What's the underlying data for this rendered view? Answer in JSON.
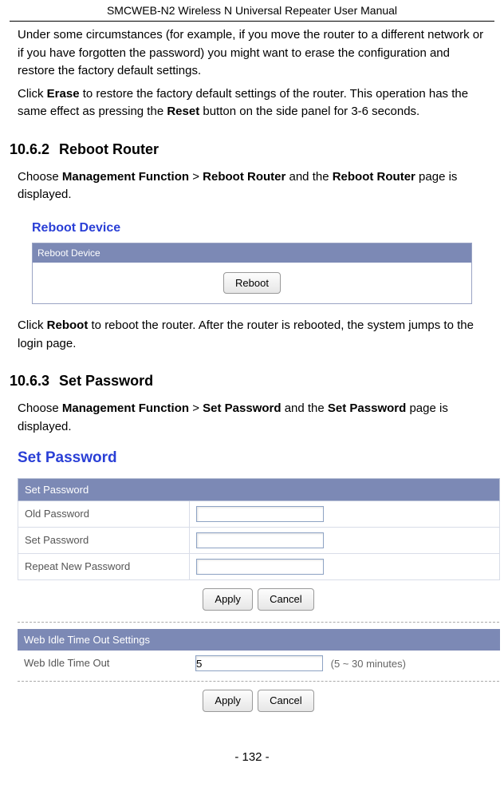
{
  "header": {
    "title": "SMCWEB-N2 Wireless N Universal Repeater User Manual"
  },
  "intro": {
    "p1": "Under some circumstances (for example, if you move the router to a different network or if you have forgotten the password) you might want to erase the configuration and restore the factory default settings.",
    "p2a": "Click ",
    "p2b": "Erase",
    "p2c": " to restore the factory default settings of the router. This operation has the same effect as pressing the ",
    "p2d": "Reset",
    "p2e": " button on the side panel for 3-6 seconds."
  },
  "sec1": {
    "num": "10.6.2",
    "title": "Reboot Router",
    "p_a": "Choose ",
    "p_b": "Management Function",
    "p_c": " > ",
    "p_d": "Reboot Router",
    "p_e": " and the ",
    "p_f": "Reboot Router",
    "p_g": " page is displayed.",
    "panel_title": "Reboot Device",
    "panel_head": "Reboot Device",
    "reboot_btn": "Reboot",
    "after_a": "Click ",
    "after_b": "Reboot",
    "after_c": " to reboot the router. After the router is rebooted, the system jumps to the login page."
  },
  "sec2": {
    "num": "10.6.3",
    "title": "Set Password",
    "p_a": "Choose ",
    "p_b": "Management Function",
    "p_c": " > ",
    "p_d": "Set Password",
    "p_e": " and the ",
    "p_f": "Set Password",
    "p_g": " page is displayed.",
    "panel_title": "Set Password",
    "th1": "Set Password",
    "row1": "Old Password",
    "row2": "Set Password",
    "row3": "Repeat New Password",
    "apply": "Apply",
    "cancel": "Cancel",
    "th2": "Web Idle Time Out Settings",
    "idle_label": "Web Idle Time Out",
    "idle_value": "5",
    "idle_hint": "(5 ~ 30 minutes)"
  },
  "footer": {
    "page": "- 132 -"
  }
}
